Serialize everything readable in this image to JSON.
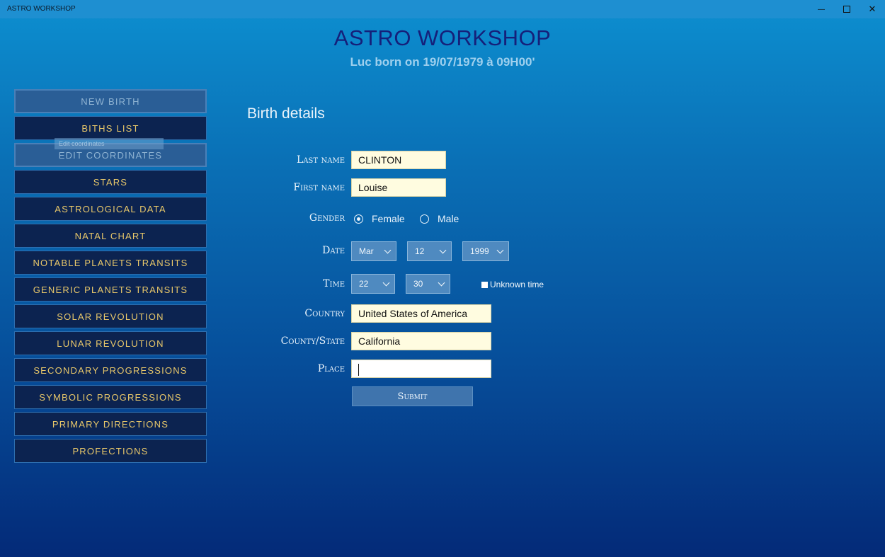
{
  "window": {
    "title": "ASTRO WORKSHOP",
    "minimize_glyph": "—",
    "close_glyph": "✕"
  },
  "header": {
    "title": "ASTRO WORKSHOP",
    "subtitle": "Luc born on 19/07/1979 à 09H00'"
  },
  "nav": {
    "items": [
      {
        "label": "NEW BIRTH"
      },
      {
        "label": "BITHS LIST"
      },
      {
        "label": "EDIT COORDINATES"
      },
      {
        "label": "STARS"
      },
      {
        "label": "ASTROLOGICAL DATA"
      },
      {
        "label": "NATAL CHART"
      },
      {
        "label": "NOTABLE PLANETS TRANSITS"
      },
      {
        "label": "GENERIC PLANETS TRANSITS"
      },
      {
        "label": "SOLAR REVOLUTION"
      },
      {
        "label": "LUNAR REVOLUTION"
      },
      {
        "label": "SECONDARY PROGRESSIONS"
      },
      {
        "label": "SYMBOLIC PROGRESSIONS"
      },
      {
        "label": "PRIMARY DIRECTIONS"
      },
      {
        "label": "PROFECTIONS"
      }
    ],
    "tooltip": "Edit coordinates"
  },
  "form": {
    "title": "Birth details",
    "last_name_label": "Last name",
    "last_name_value": "CLINTON",
    "first_name_label": "First name",
    "first_name_value": "Louise",
    "gender_label": "Gender",
    "gender_female": "Female",
    "gender_male": "Male",
    "date_label": "Date",
    "date_month": "Mar",
    "date_day": "12",
    "date_year": "1999",
    "time_label": "Time",
    "time_hour": "22",
    "time_minute": "30",
    "unknown_time_label": "Unknown time",
    "country_label": "Country",
    "country_value": "United States of America",
    "state_label": "County/State",
    "state_value": "California",
    "place_label": "Place",
    "place_value": "",
    "submit_label": "Submit"
  },
  "colors": {
    "nav_text": "#e9c86a",
    "nav_bg": "#0c2350",
    "field_bg": "#fffce0",
    "title": "#15207a"
  }
}
